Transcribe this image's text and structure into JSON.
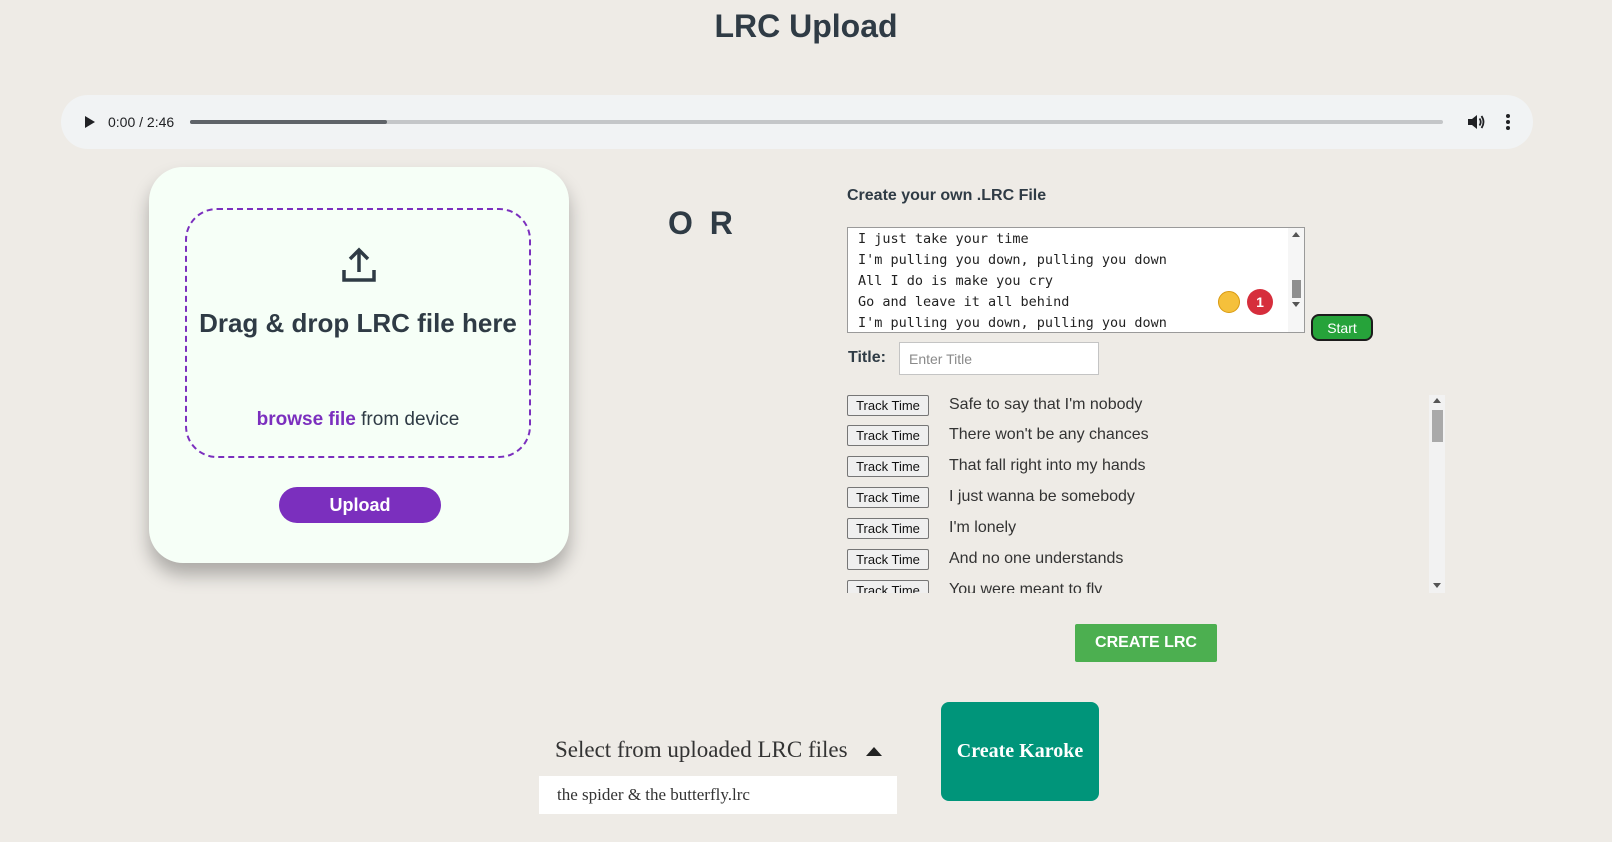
{
  "page": {
    "title": "LRC Upload"
  },
  "audio": {
    "time": "0:00 / 2:46",
    "progress_fraction": 0.157,
    "icons": {
      "play": "play-icon",
      "volume": "volume-icon",
      "more": "more-vert-icon"
    }
  },
  "upload": {
    "icon": "upload-icon",
    "drag_text": "Drag & drop LRC file here",
    "browse_link": "browse file",
    "browse_suffix": " from device",
    "button": "Upload",
    "accent": "#7b2fbe"
  },
  "or_text": "O R",
  "create": {
    "heading": "Create your own .LRC File",
    "lyrics_text": "I just take your time\nI'm pulling you down, pulling you down\nAll I do is make you cry\nGo and leave it all behind\nI'm pulling you down, pulling you down",
    "badge_count": "1",
    "start_button": "Start",
    "title_label": "Title:",
    "title_placeholder": "Enter Title",
    "track_button_label": "Track Time",
    "track_lines": [
      "Safe to say that I'm nobody",
      "There won't be any chances",
      "That fall right into my hands",
      "I just wanna be somebody",
      "I'm lonely",
      "And no one understands",
      "You were meant to fly"
    ],
    "create_button": "CREATE LRC",
    "create_color": "#4caf50"
  },
  "select": {
    "label": "Select from uploaded LRC files",
    "value": "the spider & the butterfly.lrc"
  },
  "karoke_button": "Create Karoke",
  "karoke_color": "#00957a"
}
